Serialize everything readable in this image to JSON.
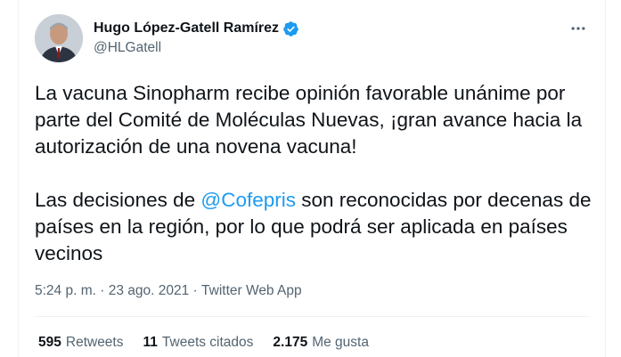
{
  "author": {
    "display_name": "Hugo López-Gatell Ramírez",
    "handle": "@HLGatell",
    "verified_icon": "verified-badge-icon",
    "verified_color": "#1d9bf0"
  },
  "tweet": {
    "paragraph1": "La vacuna Sinopharm recibe opinión favorable unánime por parte del Comité de Moléculas Nuevas, ¡gran avance hacia la autorización de una novena vacuna!",
    "paragraph2_before": "Las decisiones de ",
    "paragraph2_mention": "@Cofepris",
    "paragraph2_after": " son reconocidas por decenas de países en la región, por lo que podrá ser aplicada en países vecinos",
    "mention_color": "#1d9bf0"
  },
  "meta": {
    "time": "5:24 p. m.",
    "separator": " · ",
    "date": "23 ago. 2021",
    "source": "Twitter Web App"
  },
  "stats": {
    "retweets_count": "595",
    "retweets_label": "Retweets",
    "quotes_count": "11",
    "quotes_label": "Tweets citados",
    "likes_count": "2.175",
    "likes_label": "Me gusta"
  },
  "more_icon": "more-horizontal-icon"
}
